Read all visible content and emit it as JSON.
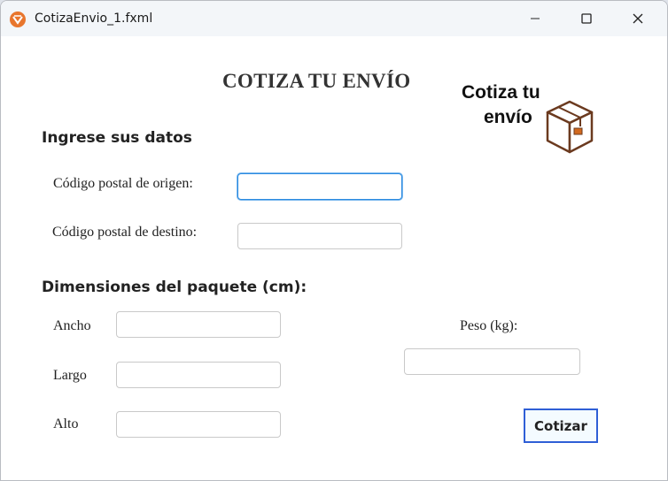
{
  "window": {
    "title": "CotizaEnvio_1.fxml",
    "app_icon": "javafx-app-icon",
    "controls": {
      "minimize": "minimize-icon",
      "maximize": "maximize-icon",
      "close": "close-icon"
    }
  },
  "header": {
    "title": "COTIZA TU ENVÍO",
    "logo_line1": "Cotiza tu",
    "logo_line2": "envío",
    "logo_icon": "package-box-icon"
  },
  "datos": {
    "section_title": "Ingrese  sus datos",
    "origin_label": "Código postal de origen:",
    "origin_value": "",
    "dest_label": "Código postal de destino:",
    "dest_value": ""
  },
  "paquete": {
    "section_title": "Dimensiones del paquete (cm):",
    "ancho_label": "Ancho",
    "ancho_value": "",
    "largo_label": "Largo",
    "largo_value": "",
    "alto_label": "Alto",
    "alto_value": "",
    "peso_label": "Peso (kg):",
    "peso_value": ""
  },
  "actions": {
    "cotizar_label": "Cotizar"
  },
  "colors": {
    "focus_border": "#2b8ae0",
    "button_border": "#2f5fd6",
    "box_brown": "#6b3a1f"
  }
}
